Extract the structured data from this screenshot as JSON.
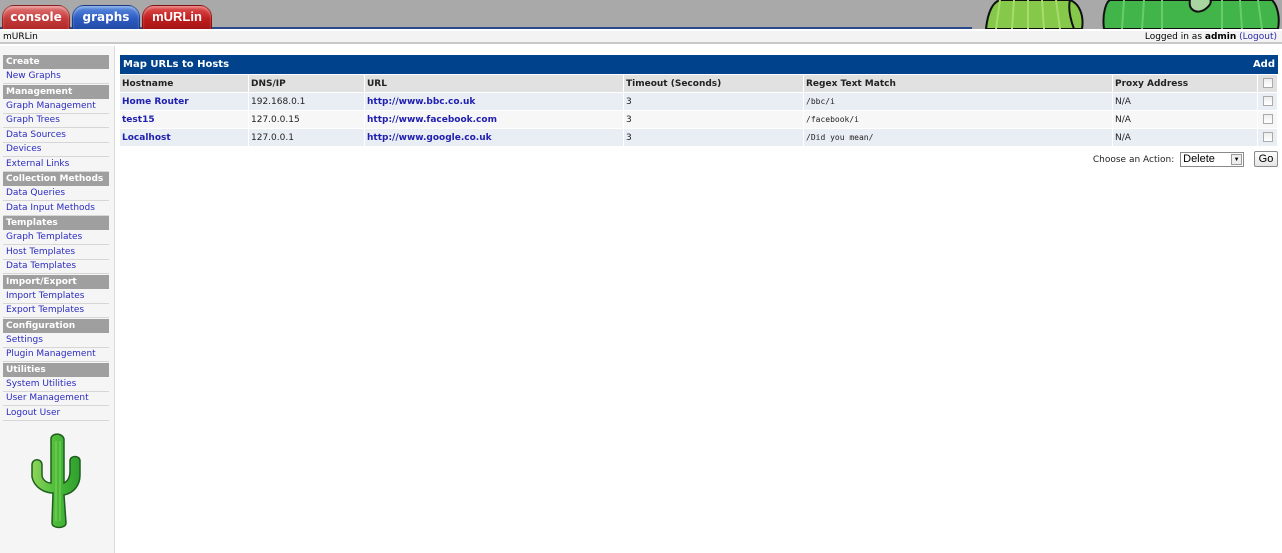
{
  "tabs": [
    {
      "label": "console"
    },
    {
      "label": "graphs"
    },
    {
      "label": "mURLin"
    }
  ],
  "breadcrumb": "mURLin",
  "login": {
    "prefix": "Logged in as",
    "user": "admin",
    "logout_label": "(Logout)"
  },
  "sidebar": {
    "sections": [
      {
        "title": "Create",
        "items": [
          "New Graphs"
        ]
      },
      {
        "title": "Management",
        "items": [
          "Graph Management",
          "Graph Trees",
          "Data Sources",
          "Devices",
          "External Links"
        ]
      },
      {
        "title": "Collection Methods",
        "items": [
          "Data Queries",
          "Data Input Methods"
        ]
      },
      {
        "title": "Templates",
        "items": [
          "Graph Templates",
          "Host Templates",
          "Data Templates"
        ]
      },
      {
        "title": "Import/Export",
        "items": [
          "Import Templates",
          "Export Templates"
        ]
      },
      {
        "title": "Configuration",
        "items": [
          "Settings",
          "Plugin Management"
        ]
      },
      {
        "title": "Utilities",
        "items": [
          "System Utilities",
          "User Management",
          "Logout User"
        ]
      }
    ],
    "logo_icon": "cactus-logo"
  },
  "panel": {
    "title": "Map URLs to Hosts",
    "add_label": "Add",
    "columns": [
      "Hostname",
      "DNS/IP",
      "URL",
      "Timeout (Seconds)",
      "Regex Text Match",
      "Proxy Address"
    ],
    "rows": [
      {
        "hostname": "Home Router",
        "ip": "192.168.0.1",
        "url": "http://www.bbc.co.uk",
        "timeout": "3",
        "regex": "/bbc/i",
        "proxy": "N/A"
      },
      {
        "hostname": "test15",
        "ip": "127.0.0.15",
        "url": "http://www.facebook.com",
        "timeout": "3",
        "regex": "/facebook/i",
        "proxy": "N/A"
      },
      {
        "hostname": "Localhost",
        "ip": "127.0.0.1",
        "url": "http://www.google.co.uk",
        "timeout": "3",
        "regex": "/Did you mean/",
        "proxy": "N/A"
      }
    ]
  },
  "actions": {
    "label": "Choose an Action:",
    "selected": "Delete",
    "go_label": "Go"
  }
}
